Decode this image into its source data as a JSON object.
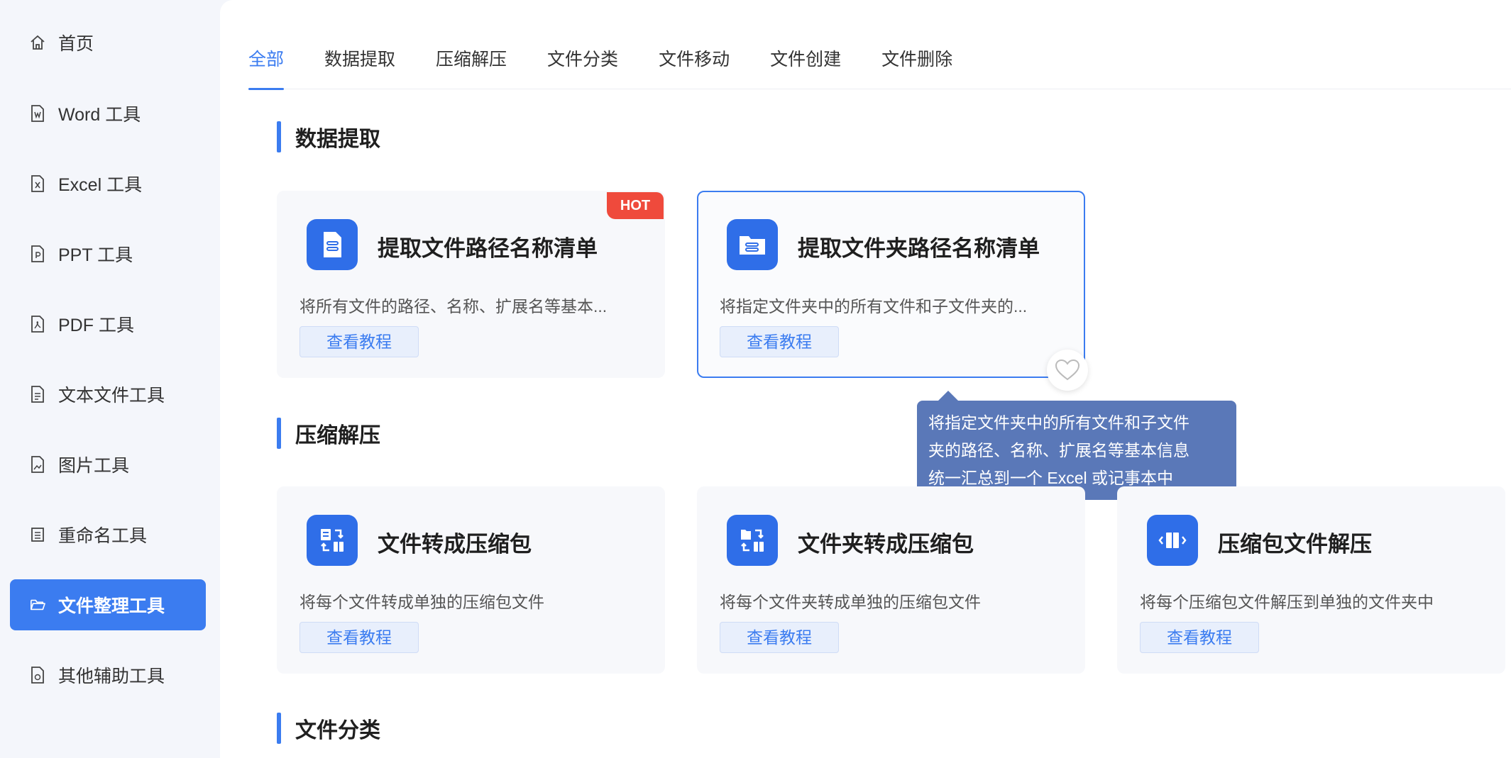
{
  "sidebar": {
    "items": [
      {
        "label": "首页",
        "icon": "home-icon"
      },
      {
        "label": "Word 工具",
        "icon": "word-file-icon"
      },
      {
        "label": "Excel 工具",
        "icon": "excel-file-icon"
      },
      {
        "label": "PPT 工具",
        "icon": "ppt-file-icon"
      },
      {
        "label": "PDF 工具",
        "icon": "pdf-file-icon"
      },
      {
        "label": "文本文件工具",
        "icon": "text-file-icon"
      },
      {
        "label": "图片工具",
        "icon": "image-file-icon"
      },
      {
        "label": "重命名工具",
        "icon": "rename-icon"
      },
      {
        "label": "文件整理工具",
        "icon": "folder-open-icon",
        "active": true
      },
      {
        "label": "其他辅助工具",
        "icon": "misc-tool-icon"
      }
    ]
  },
  "tabs": [
    "全部",
    "数据提取",
    "压缩解压",
    "文件分类",
    "文件移动",
    "文件创建",
    "文件删除"
  ],
  "sections": [
    {
      "title": "数据提取",
      "cards": [
        {
          "title": "提取文件路径名称清单",
          "desc": "将所有文件的路径、名称、扩展名等基本...",
          "button": "查看教程",
          "badge": "HOT"
        },
        {
          "title": "提取文件夹路径名称清单",
          "desc": "将指定文件夹中的所有文件和子文件夹的...",
          "button": "查看教程"
        }
      ]
    },
    {
      "title": "压缩解压",
      "cards": [
        {
          "title": "文件转成压缩包",
          "desc": "将每个文件转成单独的压缩包文件",
          "button": "查看教程"
        },
        {
          "title": "文件夹转成压缩包",
          "desc": "将每个文件夹转成单独的压缩包文件",
          "button": "查看教程"
        },
        {
          "title": "压缩包文件解压",
          "desc": "将每个压缩包文件解压到单独的文件夹中",
          "button": "查看教程"
        }
      ]
    },
    {
      "title": "文件分类"
    }
  ],
  "tooltip": {
    "lines": [
      "将指定文件夹中的所有文件和子文件",
      "夹的路径、名称、扩展名等基本信息",
      "统一汇总到一个 Excel 或记事本中"
    ]
  },
  "colors": {
    "accent": "#3b7cf0",
    "hot": "#ef4a3c",
    "tooltip": "#5a78b8"
  }
}
